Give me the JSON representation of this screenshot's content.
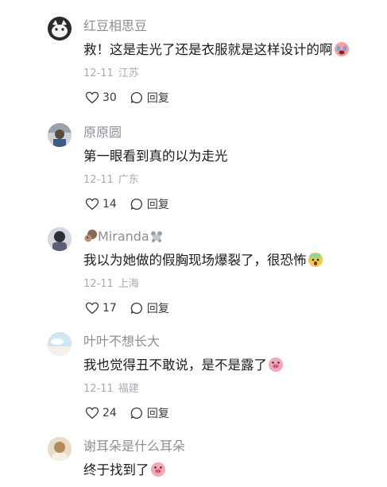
{
  "comments": [
    {
      "username": "红豆相思豆",
      "text": "救！这是走光了还是衣服就是这样设计的啊",
      "date": "12-11",
      "location": "江苏",
      "likes": "30",
      "reply_label": "回复",
      "emoji": "crying-face-emoji"
    },
    {
      "username": "原原圆",
      "text": "第一眼看到真的以为走光",
      "date": "12-11",
      "location": "广东",
      "likes": "14",
      "reply_label": "回复"
    },
    {
      "username": "Miranda",
      "text": "我以为她做的假胸现场爆裂了，很恐怖",
      "date": "12-11",
      "location": "上海",
      "likes": "17",
      "reply_label": "回复",
      "emoji": "scared-face-emoji",
      "username_icons": [
        "squirrel-emoji",
        "poodle-emoji"
      ]
    },
    {
      "username": "叶叶不想长大",
      "text": "我也觉得丑不敢说，是不是露了",
      "date": "12-11",
      "location": "福建",
      "likes": "24",
      "reply_label": "回复",
      "emoji": "pig-face-emoji"
    },
    {
      "username": "谢耳朵是什么耳朵",
      "text": "终于找到了",
      "emoji": "pig-face-emoji"
    }
  ],
  "colors": {
    "username": "#8a8f99",
    "meta": "#a7abb3",
    "text": "#1c1c1c"
  }
}
